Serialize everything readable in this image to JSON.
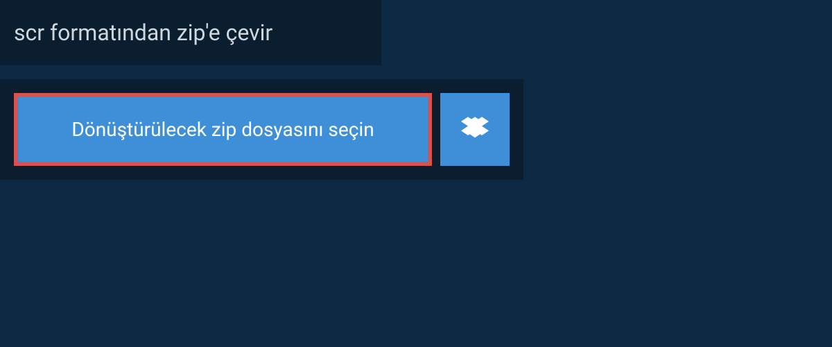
{
  "header": {
    "title": "scr formatından zip'e çevir"
  },
  "upload": {
    "file_select_label": "Dönüştürülecek zip dosyasını seçin"
  },
  "colors": {
    "page_bg": "#0c2a43",
    "panel_bg": "#0a1e30",
    "button_bg": "#3e8ed8",
    "button_highlight_border": "#d7534f",
    "text_light": "#d0d8de",
    "text_white": "#ffffff"
  }
}
